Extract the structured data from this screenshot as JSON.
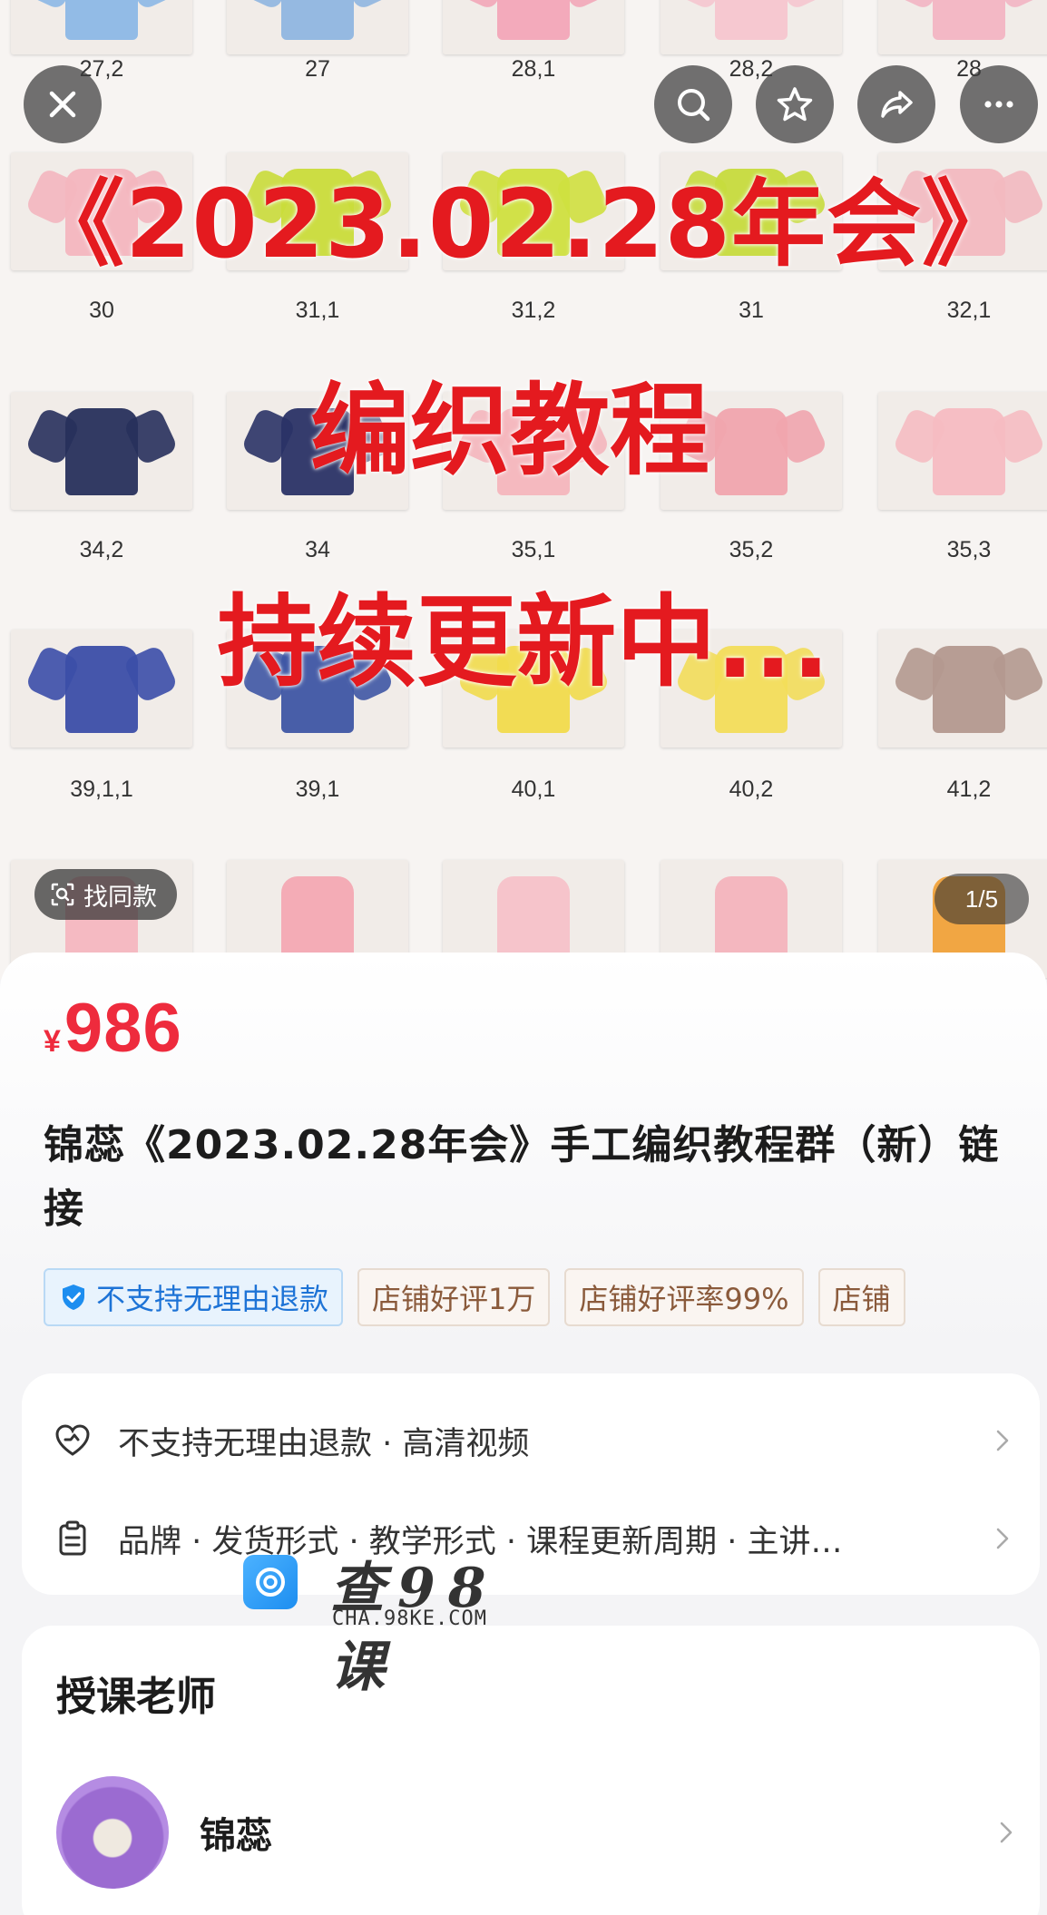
{
  "hero": {
    "thumb_rows": [
      [
        "27,2",
        "27",
        "28,1",
        "28,2",
        "28"
      ],
      [
        "30",
        "31,1",
        "31,2",
        "31",
        "32,1"
      ],
      [
        "34,2",
        "34",
        "35,1",
        "35,2",
        "35,3"
      ],
      [
        "39,1,1",
        "39,1",
        "40,1",
        "40,2",
        "41,2"
      ]
    ],
    "overlay_line1": "《2023.02.28年会》",
    "overlay_line2": "编织教程",
    "overlay_line3": "持续更新中...",
    "find_similar": "找同款",
    "pager": "1/5",
    "top_buttons": [
      "close-icon",
      "search-icon",
      "star-icon",
      "share-icon",
      "more-icon"
    ]
  },
  "product": {
    "currency": "¥",
    "price": "986",
    "title": "锦蕊《2023.02.28年会》手工编织教程群（新）链接",
    "tags": [
      "不支持无理由退款",
      "店铺好评1万",
      "店铺好评率99%",
      "店铺"
    ]
  },
  "details": {
    "row1": "不支持无理由退款 · 高清视频",
    "row2": "品牌 · 发货形式 · 教学形式 · 课程更新周期 · 主讲…"
  },
  "watermark": {
    "brand": "查98课",
    "url": "CHA.98KE.COM"
  },
  "teacher_section": {
    "title": "授课老师",
    "name": "锦蕊"
  },
  "colors": {
    "price_red": "#ee2b3d",
    "overlay_red": "#e41a1f",
    "tag_blue": "#1d73d6",
    "tag_brown": "#8a5a3b"
  }
}
